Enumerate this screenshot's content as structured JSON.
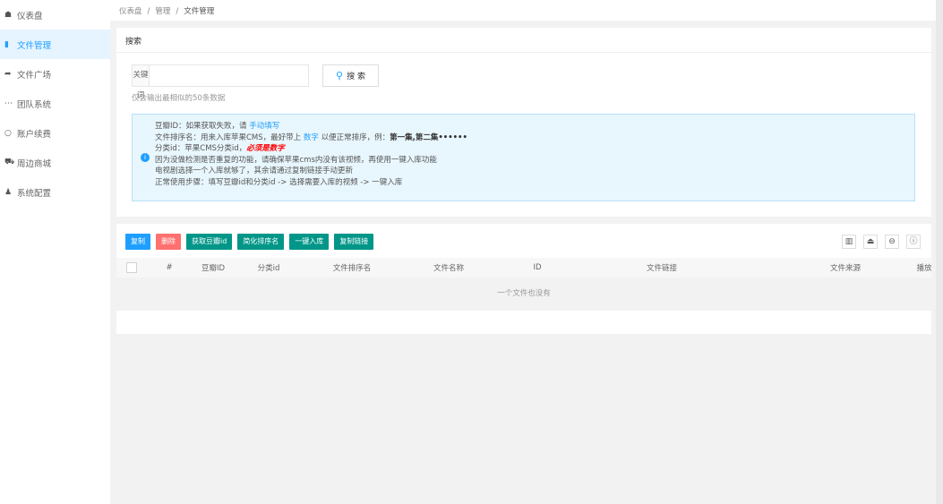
{
  "sidebar": {
    "items": [
      {
        "label": "仪表盘",
        "icon": "dashboard-icon",
        "glyph": "☗"
      },
      {
        "label": "文件管理",
        "icon": "file-icon",
        "glyph": "▮",
        "active": true
      },
      {
        "label": "文件广场",
        "icon": "share-icon",
        "glyph": "➦"
      },
      {
        "label": "团队系统",
        "icon": "more-icon",
        "glyph": "⋯"
      },
      {
        "label": "账户续费",
        "icon": "refresh-icon",
        "glyph": "○"
      },
      {
        "label": "周边商城",
        "icon": "cart-icon",
        "glyph": "⛟"
      },
      {
        "label": "系统配置",
        "icon": "user-icon",
        "glyph": "♟"
      }
    ]
  },
  "breadcrumb": [
    "仪表盘",
    "/",
    "管理",
    "/",
    "文件管理"
  ],
  "search": {
    "title": "搜索",
    "keyword_label": "关键词",
    "keyword_value": "",
    "button": "搜 索",
    "hint": "仅会输出最相似的50条数据"
  },
  "alert": {
    "l1a": "豆瓣ID：如果获取失败，请 ",
    "l1b": "手动填写",
    "l2a": "文件排序名：用来入库苹果CMS，最好带上 ",
    "l2b": "数字",
    "l2c": " 以便正常排序，例：",
    "l2d": "第一集,第二集••••••",
    "l3a": "分类id：苹果CMS分类id，",
    "l3b": "必须是数字",
    "l4": "因为没做检测是否重复的功能，请确保苹果cms内没有该视频，再使用一键入库功能",
    "l5": "电视剧选择一个入库就够了，其余请通过复制链接手动更新",
    "l6": "正常使用步骤：填写豆瓣id和分类id -> 选择需要入库的视频 -> 一键入库"
  },
  "toolbar": {
    "buttons": [
      {
        "label": "复制",
        "color": "#1e9fff"
      },
      {
        "label": "删除",
        "color": "#ff7070"
      },
      {
        "label": "获取豆瓣id",
        "color": "#009688"
      },
      {
        "label": "简化排序名",
        "color": "#009688"
      },
      {
        "label": "一键入库",
        "color": "#009688"
      },
      {
        "label": "复制链接",
        "color": "#009688"
      }
    ],
    "tools": [
      "columns-icon",
      "export-icon",
      "print-icon",
      "info-icon"
    ]
  },
  "table": {
    "columns": [
      "#",
      "豆瓣ID",
      "分类id",
      "文件排序名",
      "文件名称",
      "ID",
      "文件链接",
      "文件来源",
      "播放"
    ],
    "empty": "一个文件也没有"
  }
}
